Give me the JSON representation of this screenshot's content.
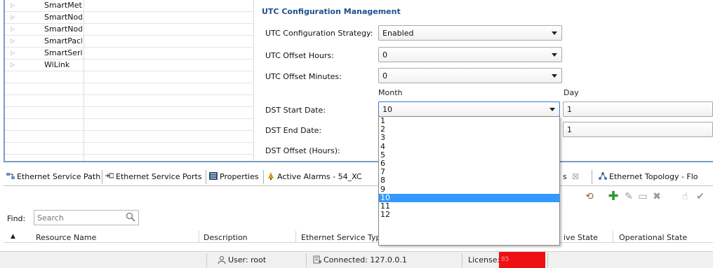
{
  "tree": {
    "items": [
      {
        "label": "SmartMetr"
      },
      {
        "label": "SmartNod"
      },
      {
        "label": "SmartNod"
      },
      {
        "label": "SmartPack"
      },
      {
        "label": "SmartSerie"
      },
      {
        "label": "WiLink"
      }
    ],
    "arrow_glyph": "▷"
  },
  "utc": {
    "title": "UTC Configuration Management",
    "strategy_label": "UTC Configuration Strategy:",
    "strategy_value": "Enabled",
    "offset_hours_label": "UTC Offset Hours:",
    "offset_hours_value": "0",
    "offset_minutes_label": "UTC Offset Minutes:",
    "offset_minutes_value": "0",
    "month_header": "Month",
    "day_header": "Day",
    "dst_start_label": "DST Start Date:",
    "dst_start_month": "10",
    "dst_start_day": "1",
    "dst_end_label": "DST End Date:",
    "dst_end_day": "1",
    "dst_offset_label": "DST Offset (Hours):"
  },
  "month_dropdown": {
    "options": [
      "1",
      "2",
      "3",
      "4",
      "5",
      "6",
      "7",
      "8",
      "9",
      "10",
      "11",
      "12"
    ],
    "selected": "10"
  },
  "tabs": [
    {
      "label": "Ethernet Service Path",
      "icon": "network-path-icon"
    },
    {
      "label": "Ethernet Service Ports",
      "icon": "ports-icon"
    },
    {
      "label": "Properties",
      "icon": "properties-icon"
    },
    {
      "label": "Active Alarms - 54_XC",
      "icon": "alarm-icon"
    },
    {
      "label": "s",
      "icon": "close-icon"
    },
    {
      "label": "Ethernet Topology - Flo",
      "icon": "topology-icon"
    }
  ],
  "toolbar": {
    "icons": [
      "refresh-icon",
      "add-icon",
      "edit-icon",
      "open-icon",
      "delete-icon",
      "approve-icon",
      "check-icon"
    ]
  },
  "find": {
    "label": "Find:",
    "placeholder": "Search"
  },
  "table": {
    "columns": [
      "Resource Name",
      "Description",
      "Ethernet Service Typ",
      "ive State",
      "Operational State"
    ]
  },
  "statusbar": {
    "user": "User: root",
    "connected": "Connected: 127.0.0.1",
    "license_label": "License:",
    "license_value": "85"
  },
  "colors": {
    "accent_title": "#1f4f8c",
    "selection": "#3399ff",
    "license_bg": "#ee1111",
    "frame_border": "#7a9cc4"
  }
}
